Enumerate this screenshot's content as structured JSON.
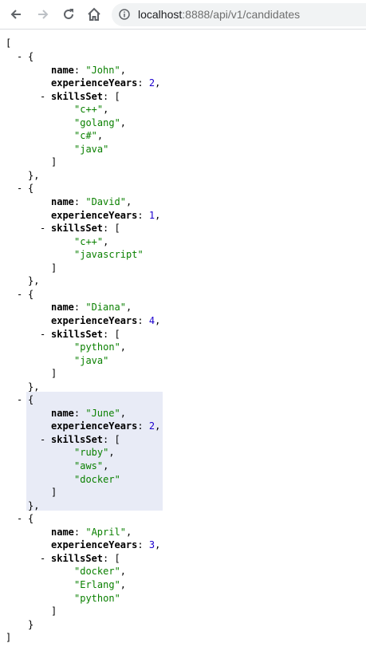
{
  "browser": {
    "url_host": "localhost",
    "url_path": ":8888/api/v1/candidates"
  },
  "json_viewer": {
    "open_bracket": "[",
    "close_bracket": "]",
    "candidates": [
      {
        "name": "\"John\"",
        "experienceYears": "2",
        "skillsSet": [
          "\"c++\"",
          "\"golang\"",
          "\"c#\"",
          "\"java\""
        ]
      },
      {
        "name": "\"David\"",
        "experienceYears": "1",
        "skillsSet": [
          "\"c++\"",
          "\"javascript\""
        ]
      },
      {
        "name": "\"Diana\"",
        "experienceYears": "4",
        "skillsSet": [
          "\"python\"",
          "\"java\""
        ]
      },
      {
        "name": "\"June\"",
        "experienceYears": "2",
        "skillsSet": [
          "\"ruby\"",
          "\"aws\"",
          "\"docker\""
        ]
      },
      {
        "name": "\"April\"",
        "experienceYears": "3",
        "skillsSet": [
          "\"docker\"",
          "\"Erlang\"",
          "\"python\""
        ]
      }
    ],
    "labels": {
      "name_key": "name",
      "experience_key": "experienceYears",
      "skills_key": "skillsSet",
      "collapse_toggle": "-"
    }
  }
}
